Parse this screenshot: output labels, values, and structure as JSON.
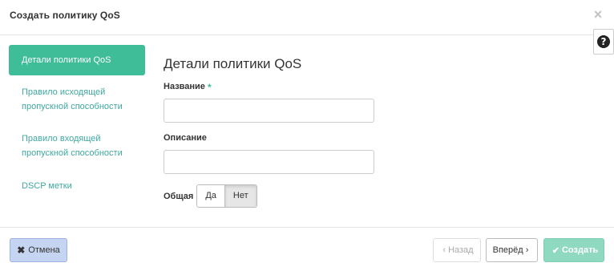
{
  "modal": {
    "title": "Создать политику QoS",
    "close_icon": "×",
    "help_icon": "?"
  },
  "nav": {
    "items": [
      {
        "label": "Детали политики QoS",
        "active": true
      },
      {
        "label": "Правило исходящей пропускной способности",
        "active": false
      },
      {
        "label": "Правило входящей пропускной способности",
        "active": false
      },
      {
        "label": "DSCP метки",
        "active": false
      }
    ]
  },
  "form": {
    "heading": "Детали политики QoS",
    "name_label": "Название",
    "required_mark": "*",
    "name_value": "",
    "description_label": "Описание",
    "description_value": "",
    "shared_label": "Общая",
    "shared_options": [
      "Да",
      "Нет"
    ],
    "shared_selected": "Нет"
  },
  "footer": {
    "cancel_label": "Отмена",
    "back_label": "Назад",
    "next_label": "Вперёд",
    "create_label": "Создать"
  },
  "colors": {
    "accent": "#3fbc98",
    "link": "#3fa89f",
    "cancel_bg": "#c5d4f0",
    "create_bg": "#8fd9c0"
  }
}
